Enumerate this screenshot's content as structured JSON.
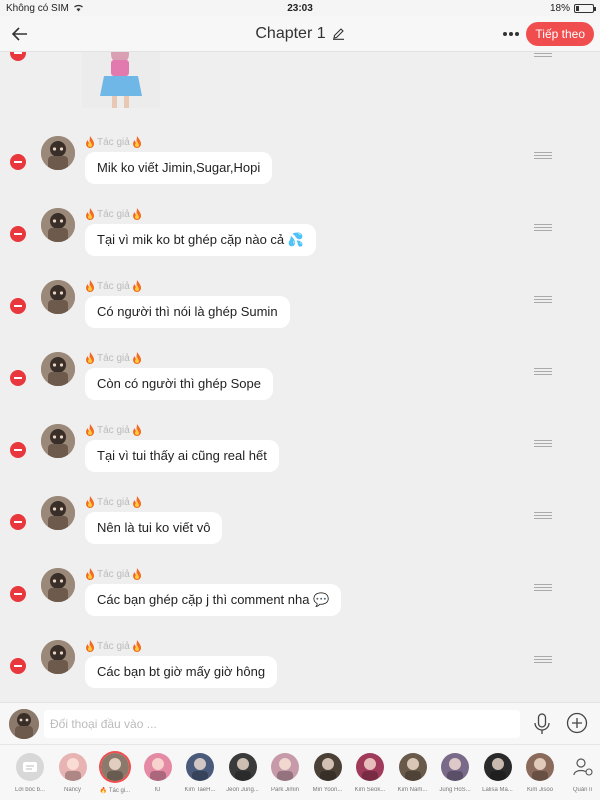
{
  "status_bar": {
    "carrier": "Không có SIM",
    "time": "23:03",
    "battery": "18%",
    "battery_level": 0.18
  },
  "header": {
    "title": "Chapter 1",
    "next_label": "Tiếp theo"
  },
  "author_label": "Tác giả",
  "messages": [
    {
      "text": "Mik ko viết Jimin,Sugar,Hopi",
      "emoji": ""
    },
    {
      "text": "Tại vì mik ko bt ghép cặp nào cả",
      "emoji": "💦"
    },
    {
      "text": "Có người thì nói là ghép Sumin",
      "emoji": ""
    },
    {
      "text": "Còn có người thì ghép Sope",
      "emoji": ""
    },
    {
      "text": "Tại vì tui thấy ai cũng real hết",
      "emoji": ""
    },
    {
      "text": "Nên là tui ko viết vô",
      "emoji": ""
    },
    {
      "text": "Các bạn ghép cặp j thì comment nha",
      "emoji": "💬"
    },
    {
      "text": "Các bạn bt giờ mấy giờ hông",
      "emoji": ""
    }
  ],
  "input": {
    "placeholder": "Đối thoại đầu vào ..."
  },
  "characters": [
    {
      "label": "Lời bốc b...",
      "color": "#d8d8d8"
    },
    {
      "label": "Nancy",
      "color": "#e8b3b3"
    },
    {
      "label": "🔥 Tác gi...",
      "color": "#8b7a6b",
      "selected": true
    },
    {
      "label": "IU",
      "color": "#e48aa4"
    },
    {
      "label": "Kim TaeH...",
      "color": "#4a5a7a"
    },
    {
      "label": "Jeon Jung...",
      "color": "#3a3a3a"
    },
    {
      "label": "Park Jimin",
      "color": "#c69aa8"
    },
    {
      "label": "Min Yoon...",
      "color": "#4b4036"
    },
    {
      "label": "Kim Seok...",
      "color": "#a03a5a"
    },
    {
      "label": "Kim Nam...",
      "color": "#6a5a4a"
    },
    {
      "label": "Jung HoS...",
      "color": "#7a6a8a"
    },
    {
      "label": "Lalisa Ma...",
      "color": "#2a2a2a"
    },
    {
      "label": "Kim Jisoo",
      "color": "#8a6a5a"
    },
    {
      "label": "Quản lí",
      "color": ""
    }
  ]
}
